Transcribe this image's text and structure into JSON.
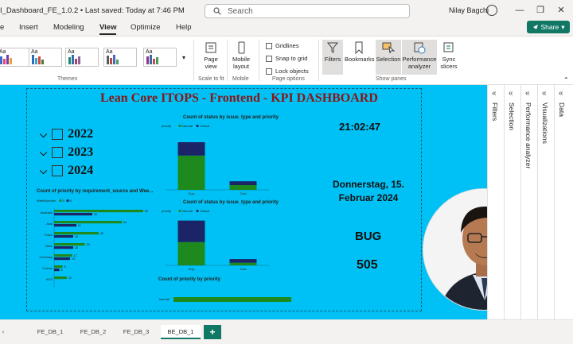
{
  "window": {
    "title": "I_Dashboard_FE_1.0.2 • Last saved: Today at 7:46 PM",
    "search_placeholder": "Search",
    "user_name": "Nilay Bagchi"
  },
  "menu": {
    "items": [
      "e",
      "Insert",
      "Modeling",
      "View",
      "Optimize",
      "Help"
    ],
    "active": "View",
    "share_label": "Share"
  },
  "ribbon": {
    "themes_label": "Themes",
    "page_view_label": "Page view",
    "scale_label": "Scale to fit",
    "mobile_layout_label": "Mobile layout",
    "mobile_group_label": "Mobile",
    "gridlines_label": "Gridlines",
    "snap_label": "Snap to grid",
    "lock_label": "Lock objects",
    "page_options_label": "Page options",
    "filters_label": "Filters",
    "bookmarks_label": "Bookmarks",
    "selection_label": "Selection",
    "performance_label": "Performance analyzer",
    "sync_label": "Sync slicers",
    "show_panes_label": "Show panes",
    "theme_tile_text": "Aa"
  },
  "report": {
    "title": "Lean Core ITOPS - Frontend - KPI DASHBOARD",
    "years": [
      "2022",
      "2023",
      "2024"
    ],
    "time": "21:02:47",
    "date_line1": "Donnerstag, 15.",
    "date_line2": "Februar 2024",
    "issue_type": "BUG",
    "count": "505",
    "colors": {
      "background": "#00c1f5",
      "green": "#1e8a1e",
      "navy": "#1a2466",
      "title": "#8b1414"
    }
  },
  "charts": {
    "status_type_title": "Count of status by issue_type and priority",
    "status_type_title2": "Count of status by issue_type and priority",
    "req_source_title": "Count of priority by requirement_source and Wee...",
    "priority_title": "Count of priority by priority",
    "legend_prefix": "priority",
    "week_legend_prefix": "WeekNumber"
  },
  "chart_data": [
    {
      "type": "bar",
      "title": "Count of status by issue_type and priority",
      "categories": [
        "Bug",
        "Task"
      ],
      "series": [
        {
          "name": "Normal",
          "values": [
            360,
            50
          ]
        },
        {
          "name": "Critical",
          "values": [
            140,
            40
          ]
        }
      ],
      "ylim": [
        0,
        600
      ]
    },
    {
      "type": "bar",
      "orientation": "horizontal",
      "title": "Count of priority by requirement_source and Wee...",
      "categories": [
        "Australia",
        "Asia",
        "Tokyo",
        "Blink",
        "Germany",
        "France",
        "KDS"
      ],
      "series": [
        {
          "name": "5",
          "values": [
            84,
            64,
            42,
            29,
            17,
            8,
            12
          ]
        },
        {
          "name": "6",
          "values": [
            36,
            21,
            18,
            18,
            15,
            5,
            0
          ]
        }
      ]
    },
    {
      "type": "bar",
      "title": "Count of status by issue_type and priority",
      "categories": [
        "Bug",
        "Task"
      ],
      "series": [
        {
          "name": "Normal",
          "values": [
            260,
            30
          ]
        },
        {
          "name": "Critical",
          "values": [
            240,
            40
          ]
        }
      ]
    },
    {
      "type": "bar",
      "orientation": "horizontal",
      "title": "Count of priority by priority",
      "categories": [
        "Normal"
      ],
      "values": [
        505
      ]
    }
  ],
  "tabs": {
    "items": [
      "FE_DB_1",
      "FE_DB_2",
      "FE_DB_3",
      "BE_DB_1"
    ],
    "active": "BE_DB_1",
    "add_label": "+"
  }
}
